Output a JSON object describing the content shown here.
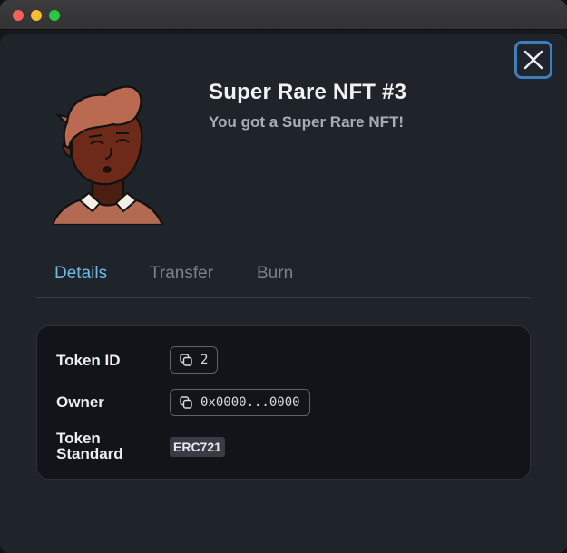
{
  "modal": {
    "title": "Super Rare NFT #3",
    "subtitle": "You got a Super Rare NFT!",
    "close_icon": "close-icon",
    "avatar_icon": "avatar-illustration"
  },
  "tabs": [
    {
      "label": "Details",
      "active": true
    },
    {
      "label": "Transfer",
      "active": false
    },
    {
      "label": "Burn",
      "active": false
    }
  ],
  "details": {
    "token_id": {
      "label": "Token ID",
      "value": "2",
      "icon": "copy-icon"
    },
    "owner": {
      "label": "Owner",
      "value": "0x0000...0000",
      "icon": "copy-icon"
    },
    "token_standard": {
      "label_line1": "Token",
      "label_line2": "Standard",
      "value": "ERC721"
    }
  },
  "colors": {
    "accent_tab": "#74b8e6",
    "close_border": "#3f7dbd",
    "modal_bg": "#1f232a",
    "card_bg": "#111418"
  }
}
